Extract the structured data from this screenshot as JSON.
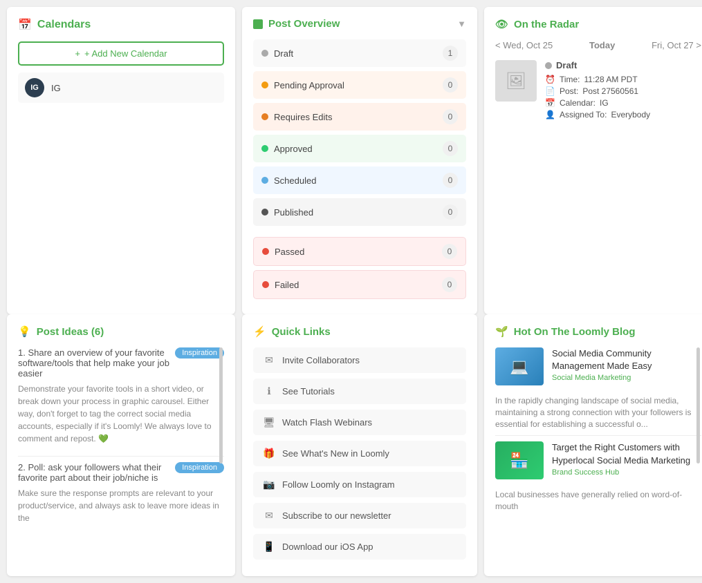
{
  "calendars": {
    "title": "Calendars",
    "add_button": "+ Add New Calendar",
    "items": [
      {
        "name": "IG",
        "abbr": "IG",
        "color": "#2c3e50"
      }
    ]
  },
  "post_overview": {
    "title": "Post Overview",
    "statuses": [
      {
        "label": "Draft",
        "count": "1",
        "dot": "gray",
        "style": "draft"
      },
      {
        "label": "Pending Approval",
        "count": "0",
        "dot": "orange",
        "style": "pending"
      },
      {
        "label": "Requires Edits",
        "count": "0",
        "dot": "dark-orange",
        "style": "requires"
      },
      {
        "label": "Approved",
        "count": "0",
        "dot": "green",
        "style": "approved"
      },
      {
        "label": "Scheduled",
        "count": "0",
        "dot": "blue",
        "style": "scheduled"
      },
      {
        "label": "Published",
        "count": "0",
        "dot": "dark",
        "style": "published"
      },
      {
        "label": "Passed",
        "count": "0",
        "dot": "pink",
        "style": "passed"
      },
      {
        "label": "Failed",
        "count": "0",
        "dot": "red",
        "style": "failed"
      }
    ]
  },
  "on_the_radar": {
    "title": "On the Radar",
    "nav_prev": "< Wed, Oct 25",
    "nav_today": "Today",
    "nav_next": "Fri, Oct 27 >",
    "post": {
      "status": "Draft",
      "time_label": "Time:",
      "time_value": "11:28 AM PDT",
      "post_label": "Post:",
      "post_value": "Post 27560561",
      "calendar_label": "Calendar:",
      "calendar_value": "IG",
      "assigned_label": "Assigned To:",
      "assigned_value": "Everybody"
    }
  },
  "post_ideas": {
    "title": "Post Ideas (6)",
    "items": [
      {
        "number": "1.",
        "title": "Share an overview of your favorite software/tools that help make your job easier",
        "badge": "Inspiration",
        "desc": "Demonstrate your favorite tools in a short video, or break down your process in graphic carousel. Either way, don't forget to tag the correct social media accounts, especially if it's Loomly! We always love to comment and repost."
      },
      {
        "number": "2.",
        "title": "Poll: ask your followers what their favorite part about their job/niche is",
        "badge": "Inspiration",
        "desc": "Make sure the response prompts are relevant to your product/service, and always ask to leave more ideas in the"
      }
    ]
  },
  "quick_links": {
    "title": "Quick Links",
    "links": [
      {
        "label": "Invite Collaborators",
        "icon": "✉"
      },
      {
        "label": "See Tutorials",
        "icon": "ℹ"
      },
      {
        "label": "Watch Flash Webinars",
        "icon": "🖥"
      },
      {
        "label": "See What's New in Loomly",
        "icon": "🎁"
      },
      {
        "label": "Follow Loomly on Instagram",
        "icon": "📷"
      },
      {
        "label": "Subscribe to our newsletter",
        "icon": "✉"
      },
      {
        "label": "Download our iOS App",
        "icon": "📱"
      }
    ]
  },
  "hot_blog": {
    "title": "Hot On The Loomly Blog",
    "articles": [
      {
        "title": "Social Media Community Management Made Easy",
        "category": "Social Media Marketing",
        "desc": "In the rapidly changing landscape of social media, maintaining a strong connection with your followers is essential for establishing a successful o..."
      },
      {
        "title": "Target the Right Customers with Hyperlocal Social Media Marketing",
        "category": "Brand Success Hub",
        "desc": "Local businesses have generally relied on word-of-mouth"
      }
    ]
  }
}
